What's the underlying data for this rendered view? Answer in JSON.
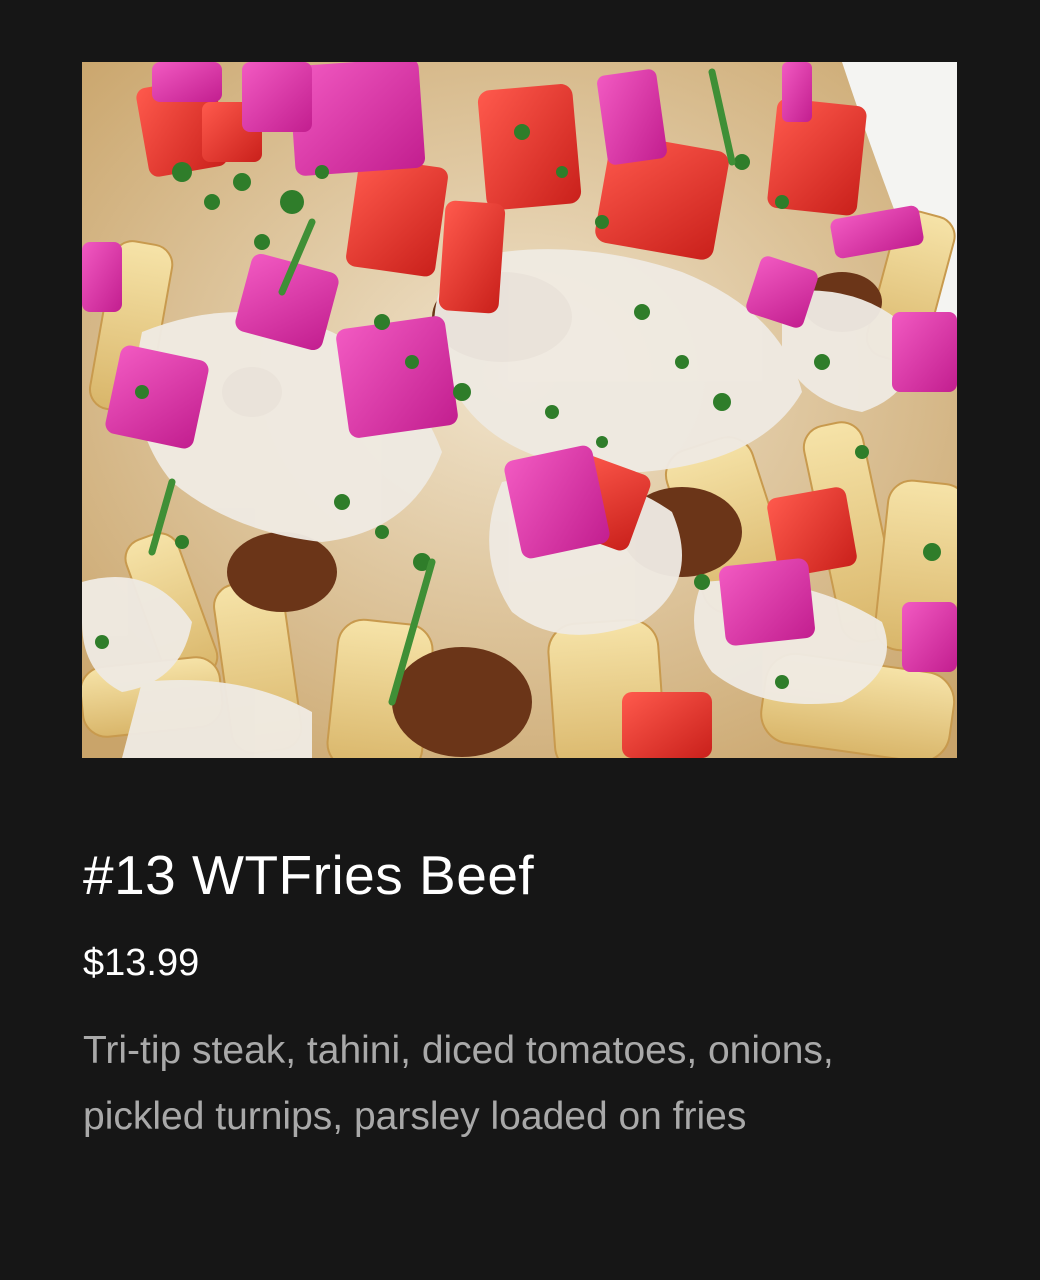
{
  "menu_item": {
    "title": "#13 WTFries Beef",
    "price": "$13.99",
    "description": "Tri-tip steak, tahini, diced tomatoes, onions, pickled turnips, parsley loaded on fries"
  },
  "image": {
    "subject": "loaded fries topped with beef, tahini, tomatoes, pickled turnips and parsley"
  },
  "colors": {
    "background": "#161616",
    "title_text": "#ffffff",
    "description_text": "#a9a9a9"
  }
}
